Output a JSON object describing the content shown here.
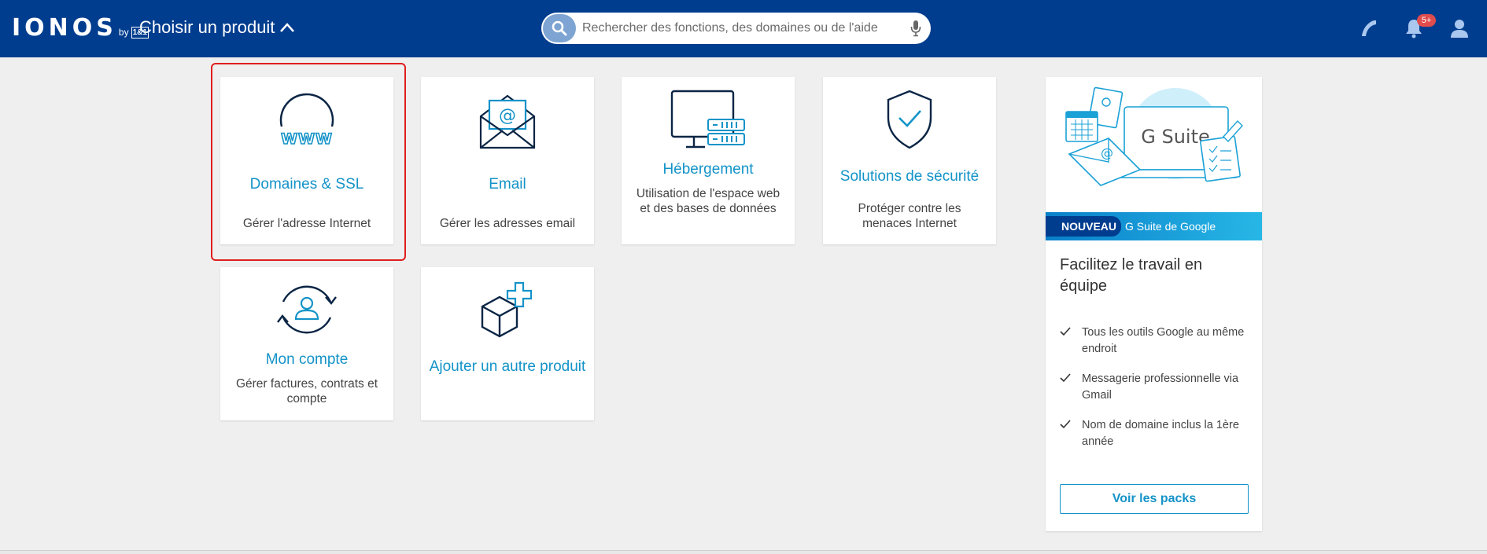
{
  "header": {
    "logo_text": "IONOS",
    "logo_by": "by",
    "logo_brand": "1&1",
    "product_chooser_label": "Choisir un produit",
    "search_placeholder": "Rechercher des fonctions, des domaines ou de l'aide",
    "notifications_badge": "5+",
    "bar_color": "#003d8f"
  },
  "tiles": [
    {
      "title": "Domaines & SSL",
      "desc": "Gérer l'adresse Internet",
      "icon": "www-globe-icon",
      "selected": true
    },
    {
      "title": "Email",
      "desc": "Gérer les adresses email",
      "icon": "email-envelope-icon"
    },
    {
      "title": "Hébergement",
      "desc": "Utilisation de l'espace web et des bases de données",
      "icon": "hosting-monitor-server-icon"
    },
    {
      "title": "Solutions de sécurité",
      "desc": "Protéger contre les menaces Internet",
      "icon": "security-shield-icon"
    },
    {
      "title": "Mon compte",
      "desc": "Gérer factures, contrats et compte",
      "icon": "account-user-cycle-icon"
    },
    {
      "title": "Ajouter un autre produit",
      "desc": "",
      "icon": "add-product-box-icon"
    }
  ],
  "promo": {
    "illustration_text": "G Suite",
    "badge": "NOUVEAU",
    "banner_text": "G Suite de Google",
    "title": "Facilitez le travail en équipe",
    "features": [
      "Tous les outils Google au même endroit",
      "Messagerie professionnelle via Gmail",
      "Nom de domaine inclus la 1ère année"
    ],
    "button_label": "Voir les packs"
  },
  "colors": {
    "accent": "#1493c8",
    "icon_dark": "#0b2545",
    "highlight": "#e01e1e"
  }
}
